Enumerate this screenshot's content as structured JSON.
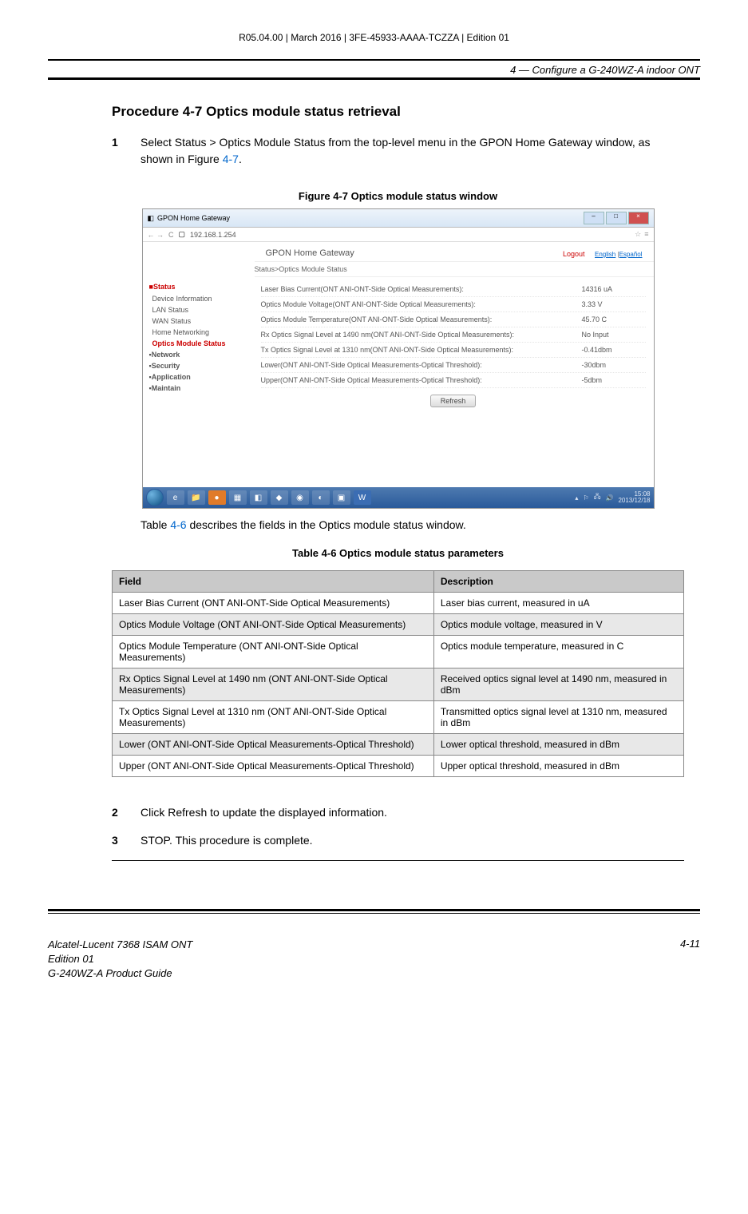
{
  "topHeader": "R05.04.00 | March 2016 | 3FE-45933-AAAA-TCZZA | Edition 01",
  "sectionHeader": "4 —  Configure a G-240WZ-A indoor ONT",
  "procedureTitle": "Procedure 4-7  Optics module status retrieval",
  "step1": {
    "num": "1",
    "pre": "Select Status > Optics Module Status from the top-level menu in the GPON Home Gateway window, as shown in Figure ",
    "link": "4-7",
    "post": "."
  },
  "figureCaption": "Figure 4-7  Optics module status window",
  "screenshot": {
    "windowTitle": "GPON Home Gateway",
    "urlArrows": "←  →",
    "urlReload": "C",
    "url": "192.168.1.254",
    "urlStar": "☆",
    "urlMenu": "≡",
    "brand": "GPON Home Gateway",
    "logout": "Logout",
    "langEnglish": "English",
    "langSep": " |",
    "langEspanol": "Español",
    "breadcrumb": "Status>Optics Module Status",
    "sidebar": {
      "statusHead": "Status",
      "items": {
        "deviceInfo": "Device Information",
        "lanStatus": "LAN Status",
        "wanStatus": "WAN Status",
        "homeNetworking": "Home Networking",
        "opticsModuleStatus": "Optics Module Status"
      },
      "collapsed": {
        "network": "Network",
        "security": "Security",
        "application": "Application",
        "maintain": "Maintain"
      }
    },
    "statusRows": [
      {
        "label": "Laser Bias Current(ONT ANI-ONT-Side Optical Measurements):",
        "value": "14316 uA"
      },
      {
        "label": "Optics Module Voltage(ONT ANI-ONT-Side Optical Measurements):",
        "value": "3.33 V"
      },
      {
        "label": "Optics Module Temperature(ONT ANI-ONT-Side Optical Measurements):",
        "value": "45.70 C"
      },
      {
        "label": "Rx Optics Signal Level at 1490 nm(ONT ANI-ONT-Side Optical Measurements):",
        "value": "No Input"
      },
      {
        "label": "Tx Optics Signal Level at 1310 nm(ONT ANI-ONT-Side Optical Measurements):",
        "value": "-0.41dbm"
      },
      {
        "label": "Lower(ONT ANI-ONT-Side Optical Measurements-Optical Threshold):",
        "value": "-30dbm"
      },
      {
        "label": "Upper(ONT ANI-ONT-Side Optical Measurements-Optical Threshold):",
        "value": "-5dbm"
      }
    ],
    "refresh": "Refresh",
    "clockTime": "15:08",
    "clockDate": "2013/12/18"
  },
  "afterTableText_pre": "Table ",
  "afterTableText_link": "4-6",
  "afterTableText_post": " describes the fields in the Optics module status window.",
  "tableCaption": "Table 4-6 Optics module status parameters",
  "tableHeaders": {
    "field": "Field",
    "desc": "Description"
  },
  "tableRows": [
    {
      "field": "Laser Bias Current (ONT ANI-ONT-Side Optical Measurements)",
      "desc": "Laser bias current, measured in uA"
    },
    {
      "field": "Optics Module Voltage (ONT ANI-ONT-Side Optical Measurements)",
      "desc": "Optics module voltage, measured in V"
    },
    {
      "field": "Optics Module Temperature (ONT ANI-ONT-Side Optical Measurements)",
      "desc": "Optics module temperature, measured in C"
    },
    {
      "field": "Rx Optics Signal Level at 1490 nm (ONT ANI-ONT-Side Optical Measurements)",
      "desc": "Received optics signal level at 1490 nm, measured in dBm"
    },
    {
      "field": "Tx Optics Signal Level at 1310 nm (ONT ANI-ONT-Side Optical Measurements)",
      "desc": "Transmitted optics signal level at 1310 nm, measured in dBm"
    },
    {
      "field": "Lower (ONT ANI-ONT-Side Optical Measurements-Optical Threshold)",
      "desc": "Lower optical threshold, measured in dBm"
    },
    {
      "field": "Upper (ONT ANI-ONT-Side Optical Measurements-Optical Threshold)",
      "desc": "Upper optical threshold, measured in dBm"
    }
  ],
  "step2": {
    "num": "2",
    "text": "Click Refresh to update the displayed information."
  },
  "step3": {
    "num": "3",
    "text": "STOP. This procedure is complete."
  },
  "footer": {
    "left1": "Alcatel-Lucent 7368 ISAM ONT",
    "left2": "Edition 01",
    "left3": "G-240WZ-A Product Guide",
    "right": "4-11"
  }
}
